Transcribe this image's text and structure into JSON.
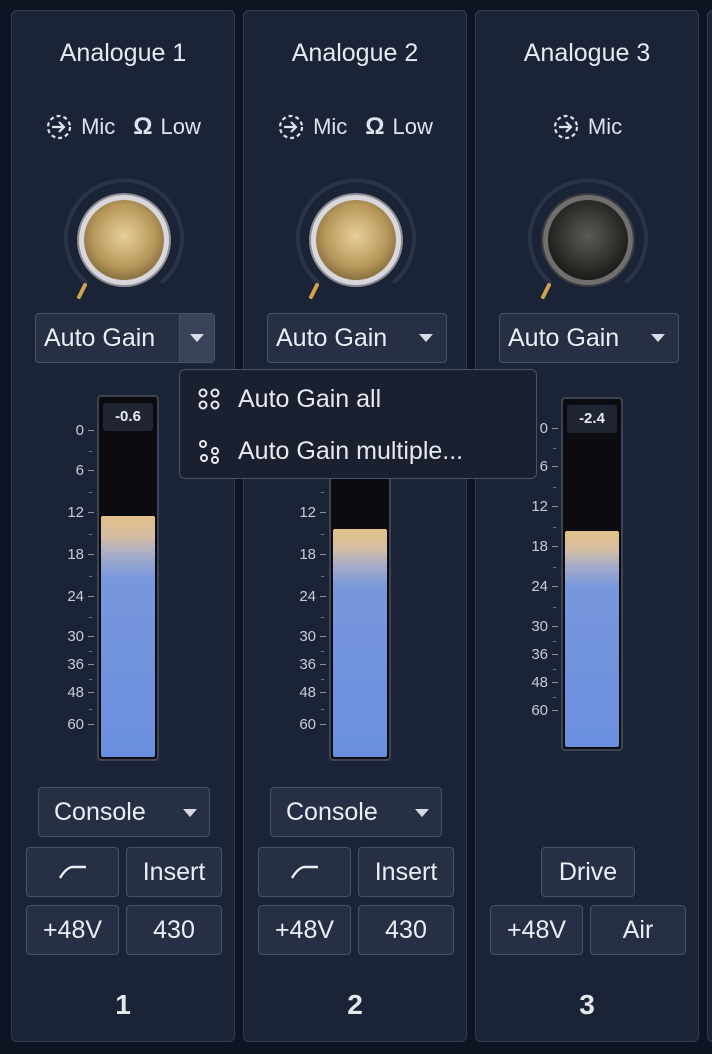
{
  "channels": [
    {
      "name": "Analogue 1",
      "inputs": [
        {
          "icon": "input-arrow-icon",
          "label": "Mic"
        },
        {
          "icon": "ohm-icon",
          "label": "Low"
        }
      ],
      "gain_level": 0.0,
      "knob_color": "#c9a96a",
      "auto_gain_label": "Auto Gain",
      "peak": "-0.6",
      "level_db": 11.5,
      "mode": "Console",
      "filter_icon": "high-pass-filter-icon",
      "insert_label": "Insert",
      "phantom_label": "+48V",
      "extra_label": "430",
      "number": "1"
    },
    {
      "name": "Analogue 2",
      "inputs": [
        {
          "icon": "input-arrow-icon",
          "label": "Mic"
        },
        {
          "icon": "ohm-icon",
          "label": "Low"
        }
      ],
      "gain_level": 0.0,
      "knob_color": "#c9a96a",
      "auto_gain_label": "Auto Gain",
      "peak": "",
      "level_db": 13.5,
      "mode": "Console",
      "filter_icon": "high-pass-filter-icon",
      "insert_label": "Insert",
      "phantom_label": "+48V",
      "extra_label": "430",
      "number": "2"
    },
    {
      "name": "Analogue 3",
      "inputs": [
        {
          "icon": "input-arrow-icon",
          "label": "Mic"
        }
      ],
      "gain_level": 0.0,
      "knob_color": "#3a3a36",
      "auto_gain_label": "Auto Gain",
      "peak": "-2.4",
      "level_db": 12.0,
      "drive_label": "Drive",
      "phantom_label": "+48V",
      "air_label": "Air",
      "number": "3"
    }
  ],
  "meter_scale": [
    "0",
    "6",
    "12",
    "18",
    "24",
    "30",
    "36",
    "48",
    "60"
  ],
  "auto_gain_menu": {
    "items": [
      {
        "icon": "grid-dots-icon",
        "label": "Auto Gain all"
      },
      {
        "icon": "scattered-dots-icon",
        "label": "Auto Gain multiple..."
      }
    ]
  },
  "colors": {
    "background": "#0f1422",
    "strip": "#1b2336",
    "meter_top": "#e2c087",
    "meter_bottom": "#6b8fe0"
  }
}
